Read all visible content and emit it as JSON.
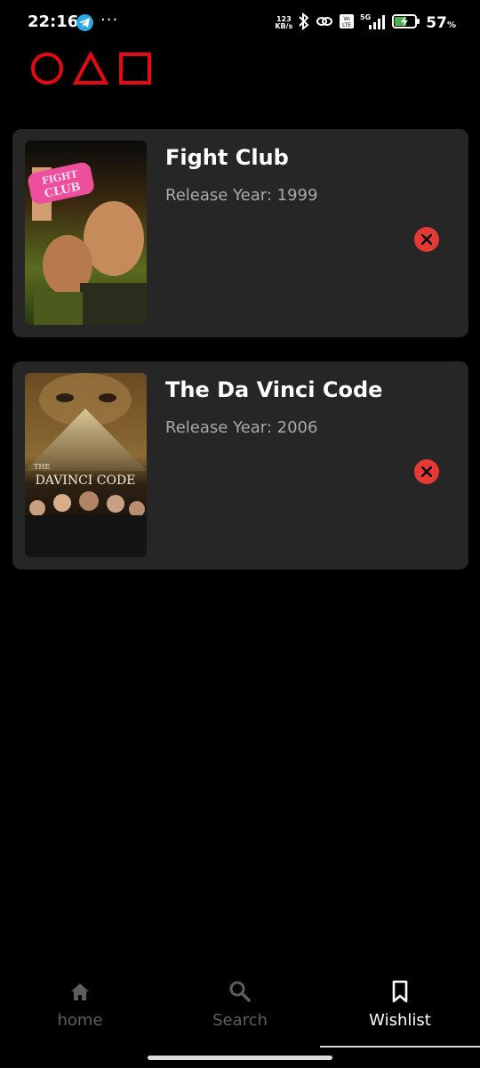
{
  "status_bar": {
    "time": "22:16",
    "network_speed_value": "123",
    "network_speed_unit": "KB/s",
    "volte_label": "Vo LTE",
    "network_type": "5G",
    "battery_percent": "57",
    "battery_unit": "%",
    "overflow": "···"
  },
  "logo": {
    "icon": "circle-triangle-square-logo",
    "color": "#e50914"
  },
  "wishlist": {
    "items": [
      {
        "title": "Fight Club",
        "year_text": "Release Year: 1999",
        "poster_caption": "FIGHT CLUB"
      },
      {
        "title": "The Da Vinci Code",
        "year_text": "Release Year: 2006",
        "poster_caption_top": "THE",
        "poster_caption_main": "DAVINCI CODE"
      }
    ]
  },
  "bottom_nav": {
    "items": [
      {
        "label": "home",
        "icon": "home-icon",
        "active": false
      },
      {
        "label": "Search",
        "icon": "search-icon",
        "active": false
      },
      {
        "label": "Wishlist",
        "icon": "bookmark-icon",
        "active": true
      }
    ]
  },
  "colors": {
    "background": "#000000",
    "card": "#262626",
    "remove": "#e53935",
    "inactive_nav": "#5d5d5d",
    "secondary_text": "#a9a9a9"
  }
}
